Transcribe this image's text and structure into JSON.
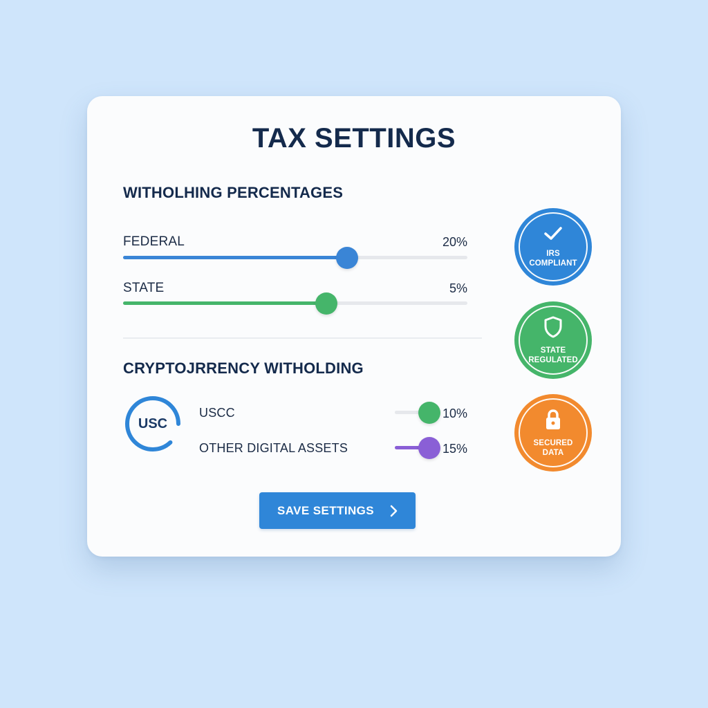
{
  "title": "TAX SETTINGS",
  "withholding": {
    "heading": "WITHOLHING PERCENTAGES",
    "federal": {
      "label": "FEDERAL",
      "value": "20%",
      "slider_fraction": 0.65,
      "color": "#3a85d6"
    },
    "state": {
      "label": "STATE",
      "value": "5%",
      "slider_fraction": 0.59,
      "color": "#45b56a"
    }
  },
  "crypto": {
    "heading": "CRYPTOЈRRENCY WITHOLDING",
    "coin_label": "USC",
    "uscc": {
      "label": "USCC",
      "value": "10%",
      "slider_fraction": 1.0,
      "color": "#45b56a"
    },
    "other": {
      "label": "OTHER DIGITAL ASSETS",
      "value": "15%",
      "slider_fraction": 1.0,
      "color": "#8a5fd6"
    }
  },
  "badges": [
    {
      "text_line1": "IRS",
      "text_line2": "COMPLIANT",
      "icon": "check-icon",
      "color": "#2f86d8"
    },
    {
      "text_line1": "STATE",
      "text_line2": "REGULATED",
      "icon": "shield-icon",
      "color": "#45b56a"
    },
    {
      "text_line1": "SECURED",
      "text_line2": "DATA",
      "icon": "lock-icon",
      "color": "#f28a2e"
    }
  ],
  "save_button": {
    "label": "SAVE SETTINGS",
    "icon": "chevron-right-icon"
  }
}
